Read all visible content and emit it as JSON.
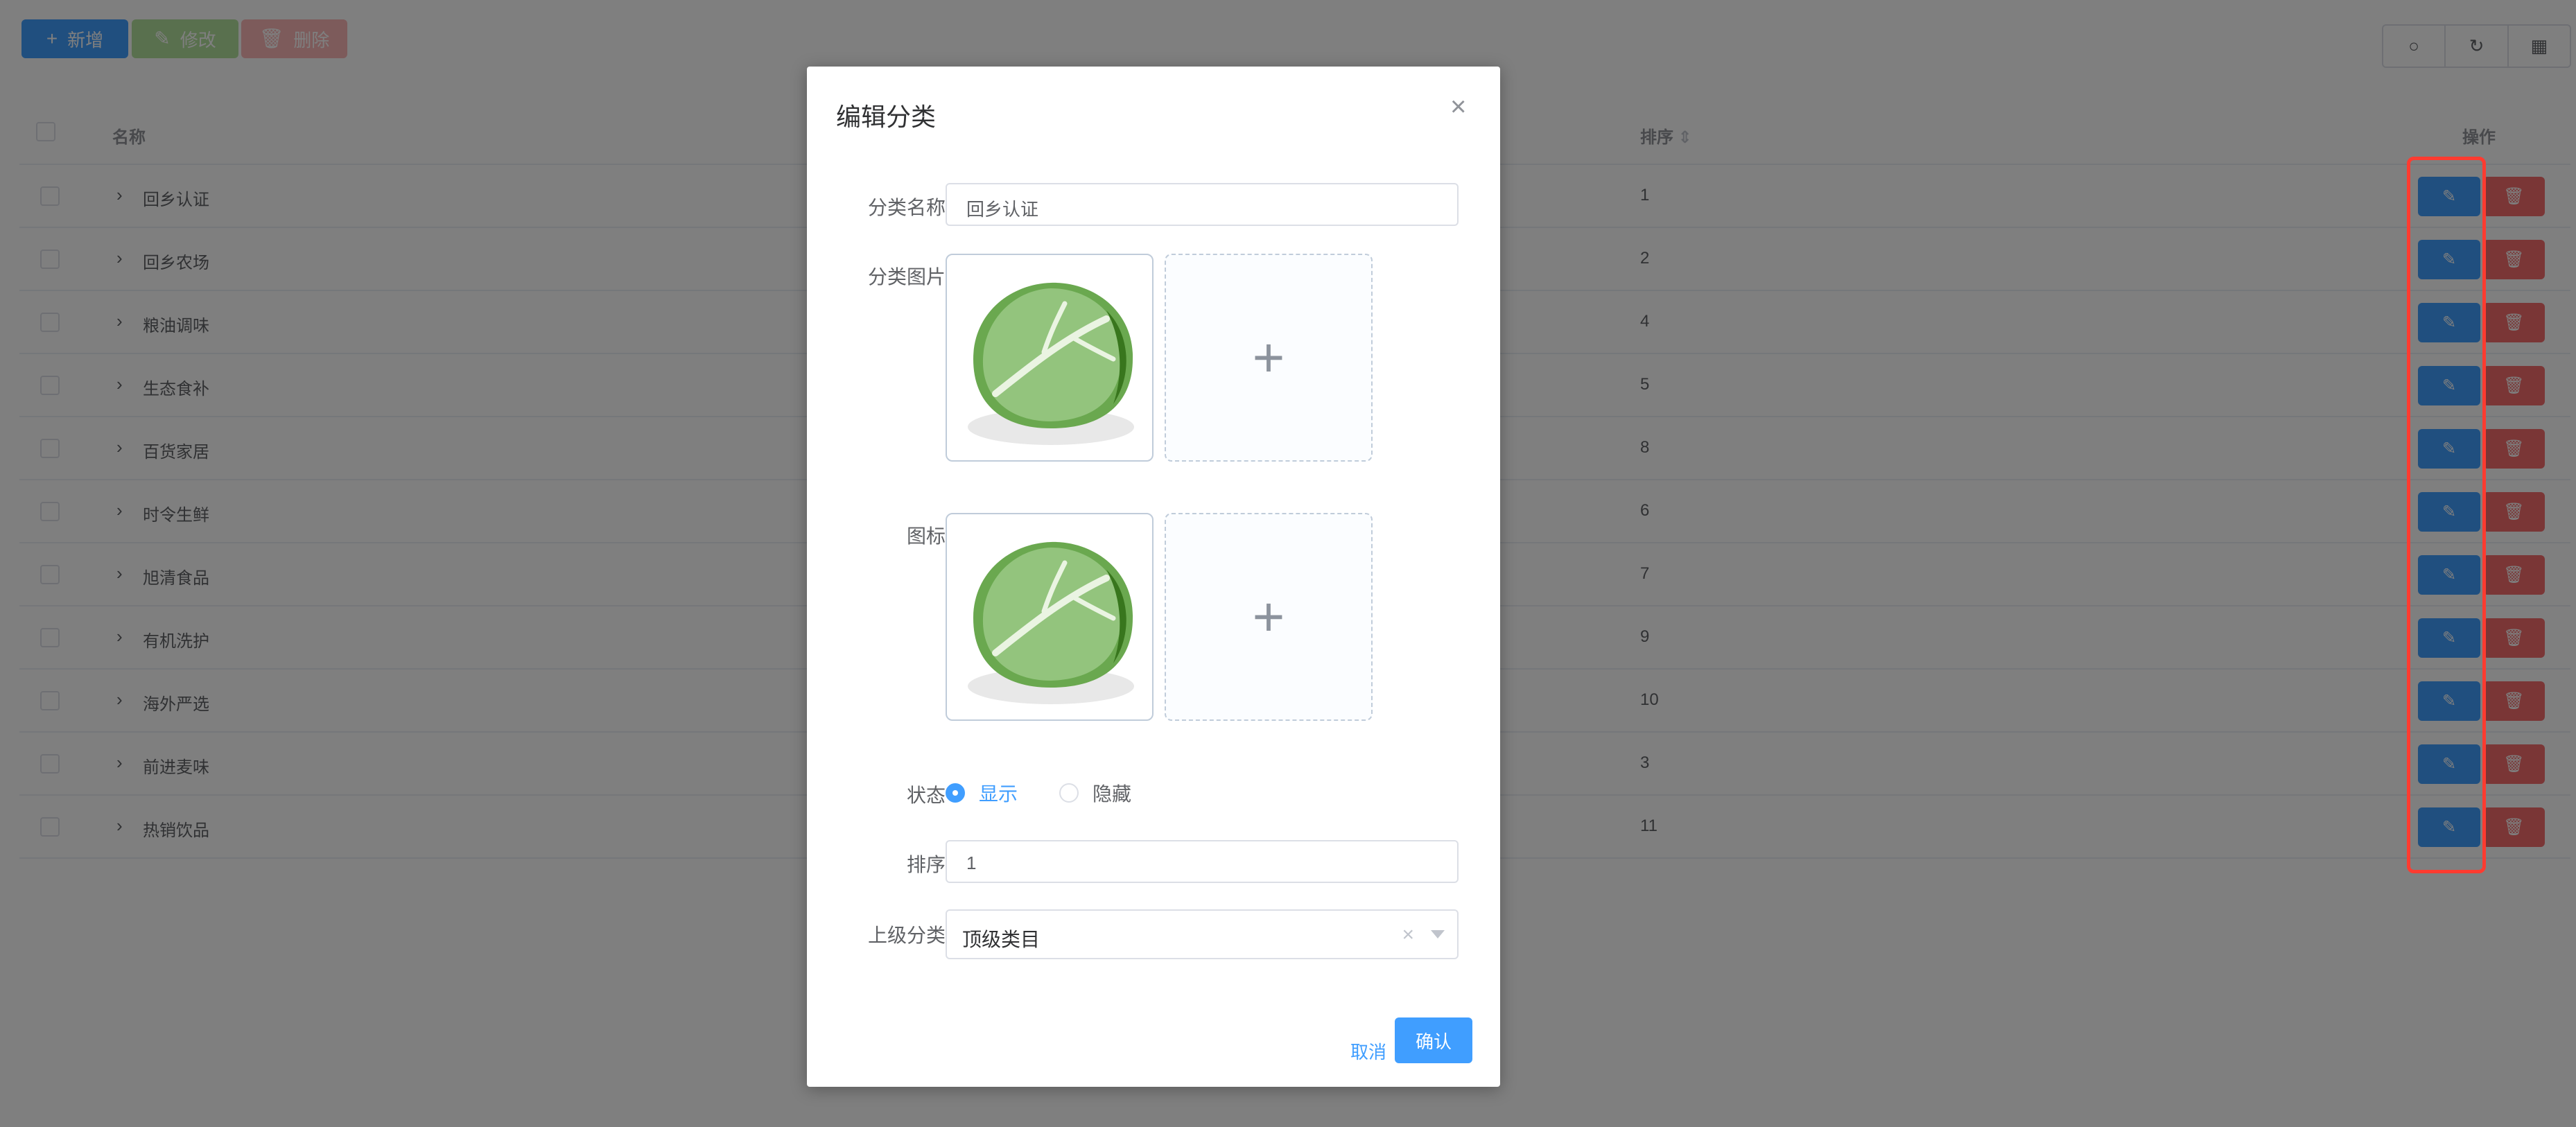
{
  "toolbar": {
    "add_label": "新增",
    "edit_label": "修改",
    "delete_label": "删除"
  },
  "table": {
    "headers": {
      "name": "名称",
      "sort": "排序",
      "action": "操作"
    },
    "rows": [
      {
        "name": "回乡认证",
        "sort": "1"
      },
      {
        "name": "回乡农场",
        "sort": "2"
      },
      {
        "name": "粮油调味",
        "sort": "4"
      },
      {
        "name": "生态食补",
        "sort": "5"
      },
      {
        "name": "百货家居",
        "sort": "8"
      },
      {
        "name": "时令生鲜",
        "sort": "6"
      },
      {
        "name": "旭清食品",
        "sort": "7"
      },
      {
        "name": "有机洗护",
        "sort": "9"
      },
      {
        "name": "海外严选",
        "sort": "10"
      },
      {
        "name": "前进麦味",
        "sort": "3"
      },
      {
        "name": "热销饮品",
        "sort": "11"
      }
    ]
  },
  "dialog": {
    "title": "编辑分类",
    "category_name_label": "分类名称",
    "category_name_value": "回乡认证",
    "category_image_label": "分类图片",
    "icon_label": "图标",
    "status_label": "状态",
    "status_show": "显示",
    "status_hide": "隐藏",
    "sort_label": "排序",
    "sort_value": "1",
    "parent_label": "上级分类",
    "parent_value": "顶级类目",
    "cancel_label": "取消",
    "confirm_label": "确认"
  },
  "colors": {
    "primary": "#409eff",
    "danger": "#f56c6c",
    "success_light": "#b3e19d",
    "highlight": "#ff3b30"
  }
}
